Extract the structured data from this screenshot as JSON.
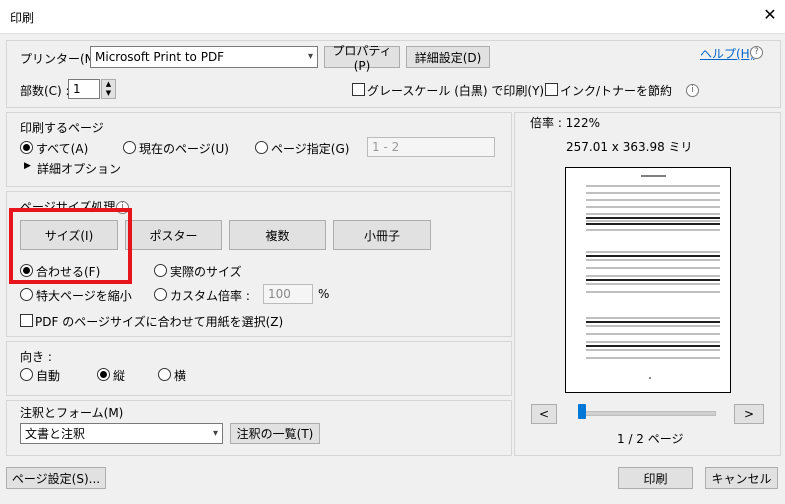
{
  "window": {
    "title": "印刷"
  },
  "printer": {
    "label": "プリンター(N) :",
    "selected": "Microsoft Print to PDF",
    "properties_btn": "プロパティ(P)",
    "advanced_btn": "詳細設定(D)",
    "help_link": "ヘルプ(H)"
  },
  "copies": {
    "label": "部数(C) :",
    "value": "1"
  },
  "options": {
    "grayscale": "グレースケール (白黒) で印刷(Y)",
    "save_ink": "インク/トナーを節約"
  },
  "pages_to_print": {
    "title": "印刷するページ",
    "all": "すべて(A)",
    "current": "現在のページ(U)",
    "pages": "ページ指定(G)",
    "range_placeholder": "1 - 2",
    "more_options": "詳細オプション"
  },
  "page_sizing": {
    "title": "ページサイズ処理",
    "buttons": [
      "サイズ(I)",
      "ポスター",
      "複数",
      "小冊子"
    ],
    "fit": "合わせる(F)",
    "actual": "実際のサイズ",
    "shrink": "特大ページを縮小",
    "custom_scale": "カスタム倍率 :",
    "custom_value": "100",
    "percent": "%",
    "choose_paper": "PDF のページサイズに合わせて用紙を選択(Z)"
  },
  "orientation": {
    "title": "向き :",
    "auto": "自動",
    "portrait": "縦",
    "landscape": "横"
  },
  "comments": {
    "title": "注釈とフォーム(M)",
    "selected": "文書と注釈",
    "summary_btn": "注釈の一覧(T)"
  },
  "preview": {
    "scale": "倍率 : 122%",
    "dims": "257.01 x 363.98 ミリ",
    "page_indicator": "1 / 2 ページ",
    "page_fraction": 0.0
  },
  "footer": {
    "page_setup": "ページ設定(S)...",
    "print": "印刷",
    "cancel": "キャンセル"
  }
}
